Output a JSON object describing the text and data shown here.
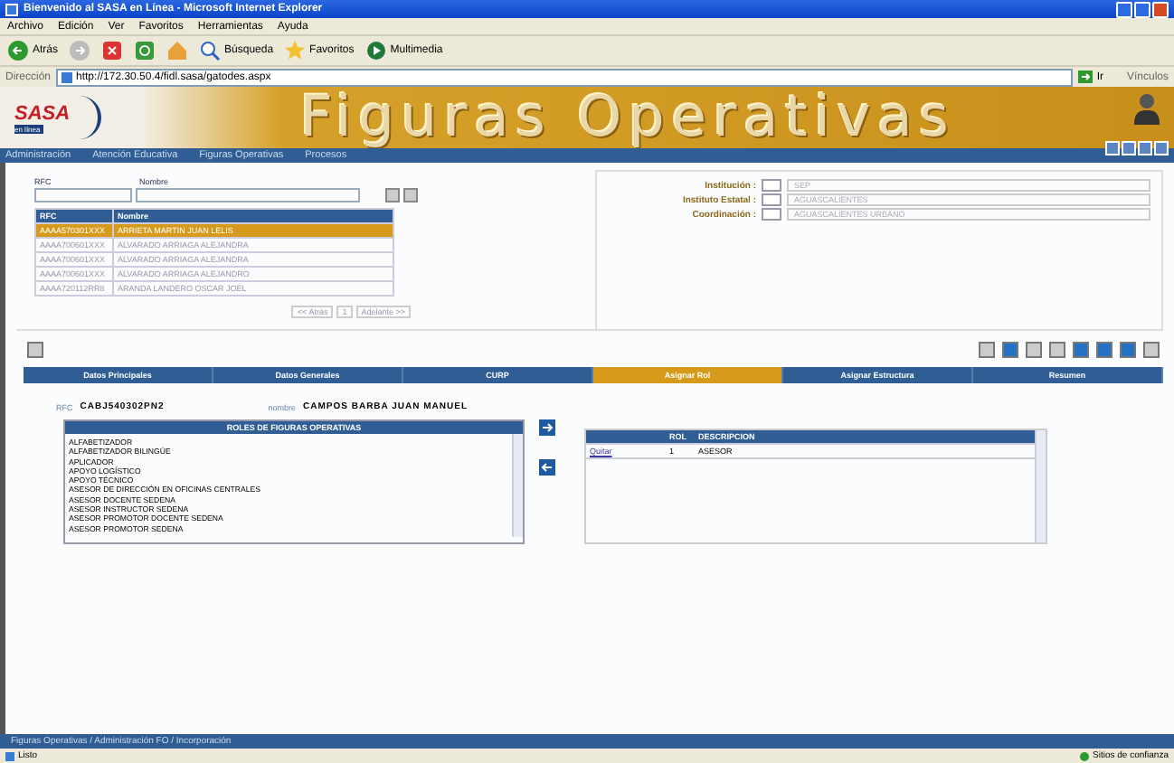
{
  "window": {
    "title": "Bienvenido al SASA en Línea - Microsoft Internet Explorer"
  },
  "menu": [
    "Archivo",
    "Edición",
    "Ver",
    "Favoritos",
    "Herramientas",
    "Ayuda"
  ],
  "toolbar": [
    {
      "kind": "back",
      "label": "Atrás"
    },
    {
      "kind": "forward"
    },
    {
      "kind": "stop"
    },
    {
      "kind": "refresh"
    },
    {
      "kind": "home"
    },
    {
      "kind": "search",
      "label": "Búsqueda"
    },
    {
      "kind": "favorites",
      "label": "Favoritos"
    },
    {
      "kind": "media",
      "label": "Multimedia"
    }
  ],
  "address": {
    "label": "Dirección",
    "value": "http://172.30.50.4/fidl.sasa/gatodes.aspx",
    "go": "Ir",
    "links": "Vínculos"
  },
  "header": {
    "logo": "SASA",
    "tagline": "en línea",
    "banner": "Figuras Operativas"
  },
  "nav": [
    "Administración",
    "Atención Educativa",
    "Figuras Operativas",
    "Procesos"
  ],
  "search": {
    "rfc_label": "RFC",
    "name_label": "Nombre"
  },
  "results": {
    "columns": [
      "RFC",
      "Nombre"
    ],
    "rows": [
      {
        "rfc": "AAAA570301XXX",
        "name": "ARRIETA MARTIN JUAN LELIS",
        "selected": true
      },
      {
        "rfc": "AAAA700601XXX",
        "name": "ALVARADO ARRIAGA ALEJANDRA",
        "selected": false
      },
      {
        "rfc": "AAAA700601XXX",
        "name": "ALVARADO ARRIAGA ALEJANDRA",
        "selected": false
      },
      {
        "rfc": "AAAA700601XXX",
        "name": "ALVARADO ARRIAGA ALEJANDRO",
        "selected": false
      },
      {
        "rfc": "AAAA720112RR8",
        "name": "ARANDA LANDERO OSCAR JOEL",
        "selected": false
      }
    ],
    "pager": {
      "prev": "<< Atrás",
      "page": "1",
      "next": "Adelante >>"
    }
  },
  "filters": [
    {
      "label": "Institución :",
      "value": "SEP"
    },
    {
      "label": "Instituto Estatal :",
      "value": "AGUASCALIENTES"
    },
    {
      "label": "Coordinación :",
      "value": "AGUASCALIENTES URBANO"
    }
  ],
  "actions": [
    {
      "kind": "plain"
    },
    {
      "kind": "blue"
    },
    {
      "kind": "plain"
    },
    {
      "kind": "plain"
    },
    {
      "kind": "blue"
    },
    {
      "kind": "blue"
    },
    {
      "kind": "blue"
    },
    {
      "kind": "plain"
    }
  ],
  "tabs": [
    {
      "label": "Datos Principales",
      "selected": false
    },
    {
      "label": "Datos Generales",
      "selected": false
    },
    {
      "label": "CURP",
      "selected": false
    },
    {
      "label": "Asignar Rol",
      "selected": true
    },
    {
      "label": "Asignar Estructura",
      "selected": false
    },
    {
      "label": "Resumen",
      "selected": false
    }
  ],
  "person": {
    "rfc_label": "RFC",
    "rfc": "CABJ540302PN2",
    "name_label": "nombre",
    "name": "CAMPOS BARBA JUAN MANUEL"
  },
  "roles": {
    "title": "ROLES DE FIGURAS OPERATIVAS",
    "items": [
      "ALFABETIZADOR",
      "ALFABETIZADOR BILINGÜE",
      "APLICADOR",
      "APOYO LOGÍSTICO",
      "APOYO TÉCNICO",
      "ASESOR DE DIRECCIÓN EN OFICINAS CENTRALES",
      "ASESOR DOCENTE SEDENA",
      "ASESOR INSTRUCTOR SEDENA",
      "ASESOR PROMOTOR DOCENTE SEDENA",
      "ASESOR PROMOTOR SEDENA"
    ]
  },
  "assigned": {
    "columns": [
      "",
      "ROL",
      "DESCRIPCION"
    ],
    "rows": [
      {
        "action": "Quitar",
        "rol": "1",
        "description": "ASESOR"
      }
    ]
  },
  "breadcrumb": "Figuras Operativas / Administración FO / Incorporación",
  "status": {
    "text": "Listo",
    "zone": "Sitios de confianza"
  }
}
